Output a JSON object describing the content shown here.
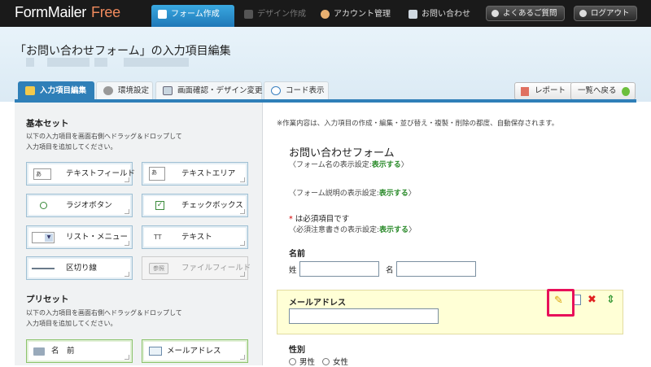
{
  "topbar": {
    "logo_main": "FormMailer",
    "logo_free": "Free",
    "nav": [
      {
        "label": "フォーム作成"
      },
      {
        "label": "デザイン作成"
      },
      {
        "label": "アカウント管理"
      },
      {
        "label": "お問い合わせ"
      }
    ],
    "faq_label": "よくあるご質問",
    "logout_label": "ログアウト"
  },
  "page": {
    "title": "「お問い合わせフォーム」の入力項目編集"
  },
  "subtabs": [
    {
      "label": "入力項目編集"
    },
    {
      "label": "環境設定"
    },
    {
      "label": "画面確認・デザイン変更"
    },
    {
      "label": "コード表示"
    }
  ],
  "actions": {
    "report_label": "レポート",
    "back_label": "一覧へ戻る"
  },
  "left": {
    "basic_heading": "基本セット",
    "basic_note_1": "以下の入力項目を画面右側へドラッグ＆ドロップして",
    "basic_note_2": "入力項目を追加してください。",
    "basic_items": [
      {
        "label": "テキストフィールド",
        "icon_text": "あ"
      },
      {
        "label": "テキストエリア",
        "icon_text": "あ"
      },
      {
        "label": "ラジオボタン"
      },
      {
        "label": "チェックボックス"
      },
      {
        "label": "リスト・メニュー"
      },
      {
        "label": "テキスト",
        "icon_text": "TT"
      },
      {
        "label": "区切り線"
      },
      {
        "label": "ファイルフィールド",
        "icon_text": "参照"
      }
    ],
    "preset_heading": "プリセット",
    "preset_note_1": "以下の入力項目を画面右側へドラッグ＆ドロップして",
    "preset_note_2": "入力項目を追加してください。",
    "preset_items": [
      {
        "label": "名　前"
      },
      {
        "label": "メールアドレス"
      }
    ]
  },
  "right": {
    "notice": "※作業内容は、入力項目の作成・編集・並び替え・複製・削除の都度、自動保存されます。",
    "form_title": "お問い合わせフォーム",
    "form_name_setting_prefix": "〈フォーム名の表示設定:",
    "form_desc_setting_prefix": "〈フォーム説明の表示設定:",
    "show_label": "表示する",
    "setting_suffix": "〉",
    "required_mark": "*",
    "required_text": " は必須項目です",
    "required_setting_prefix": "〈必須注意書きの表示設定:",
    "name_label": "名前",
    "last_name": "姓",
    "first_name": "名",
    "email_label": "メールアドレス",
    "gender_label": "性別",
    "male": "男性",
    "female": "女性"
  },
  "colors": {
    "accent_blue": "#2f7fb8",
    "highlight_yellow": "#ffffd6",
    "callout_pink": "#e8105a",
    "show_green": "#2a8a2a"
  }
}
